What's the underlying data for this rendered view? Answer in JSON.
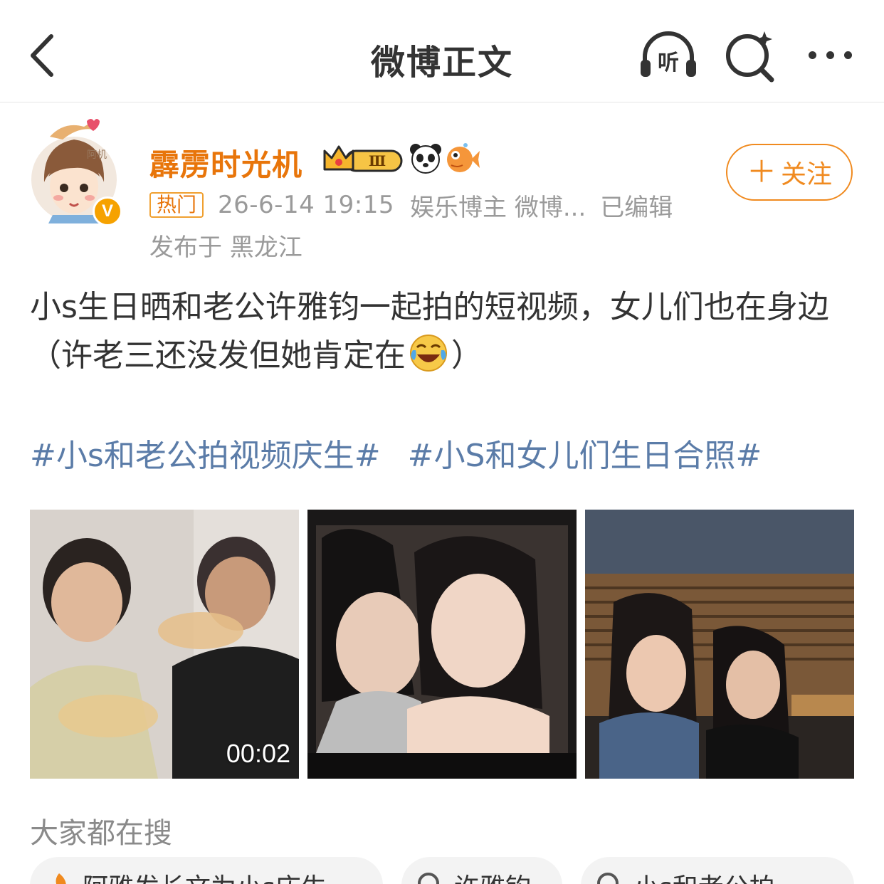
{
  "nav": {
    "title": "微博正文",
    "listen_label": "听"
  },
  "author": {
    "name": "霹雳时光机",
    "verified_letter": "V",
    "avatar_text": "阿机",
    "membership_level": "Ⅲ"
  },
  "follow": {
    "label": "关注"
  },
  "meta": {
    "hot_tag": "热门",
    "time": "26-6-14 19:15",
    "role": "娱乐博主 微博...",
    "edited": "已编辑",
    "location": "发布于 黑龙江"
  },
  "post": {
    "text_before_emoji": "小s生日晒和老公许雅钧一起拍的短视频，女儿们也在身边（许老三还没发但她肯定在",
    "text_after_emoji": "）",
    "hashtags": [
      "#小s和老公拍视频庆生#",
      "#小S和女儿们生日合照#"
    ]
  },
  "media": {
    "video_duration": "00:02"
  },
  "search_section": {
    "title": "大家都在搜",
    "chips": [
      "阿雅发长文为小s庆生",
      "许雅钧",
      "小s和老公拍"
    ]
  },
  "colors": {
    "accent_orange": "#f08a1f",
    "name_orange": "#e8750a",
    "topic_blue": "#5b7ca8",
    "meta_gray": "#9a9a9a"
  },
  "icons": [
    "back-arrow-icon",
    "listen-icon",
    "search-icon",
    "more-icon",
    "crown-icon",
    "panda-icon",
    "fish-icon",
    "laugh-cry-emoji-icon",
    "hot-search-icon",
    "search-icon"
  ]
}
